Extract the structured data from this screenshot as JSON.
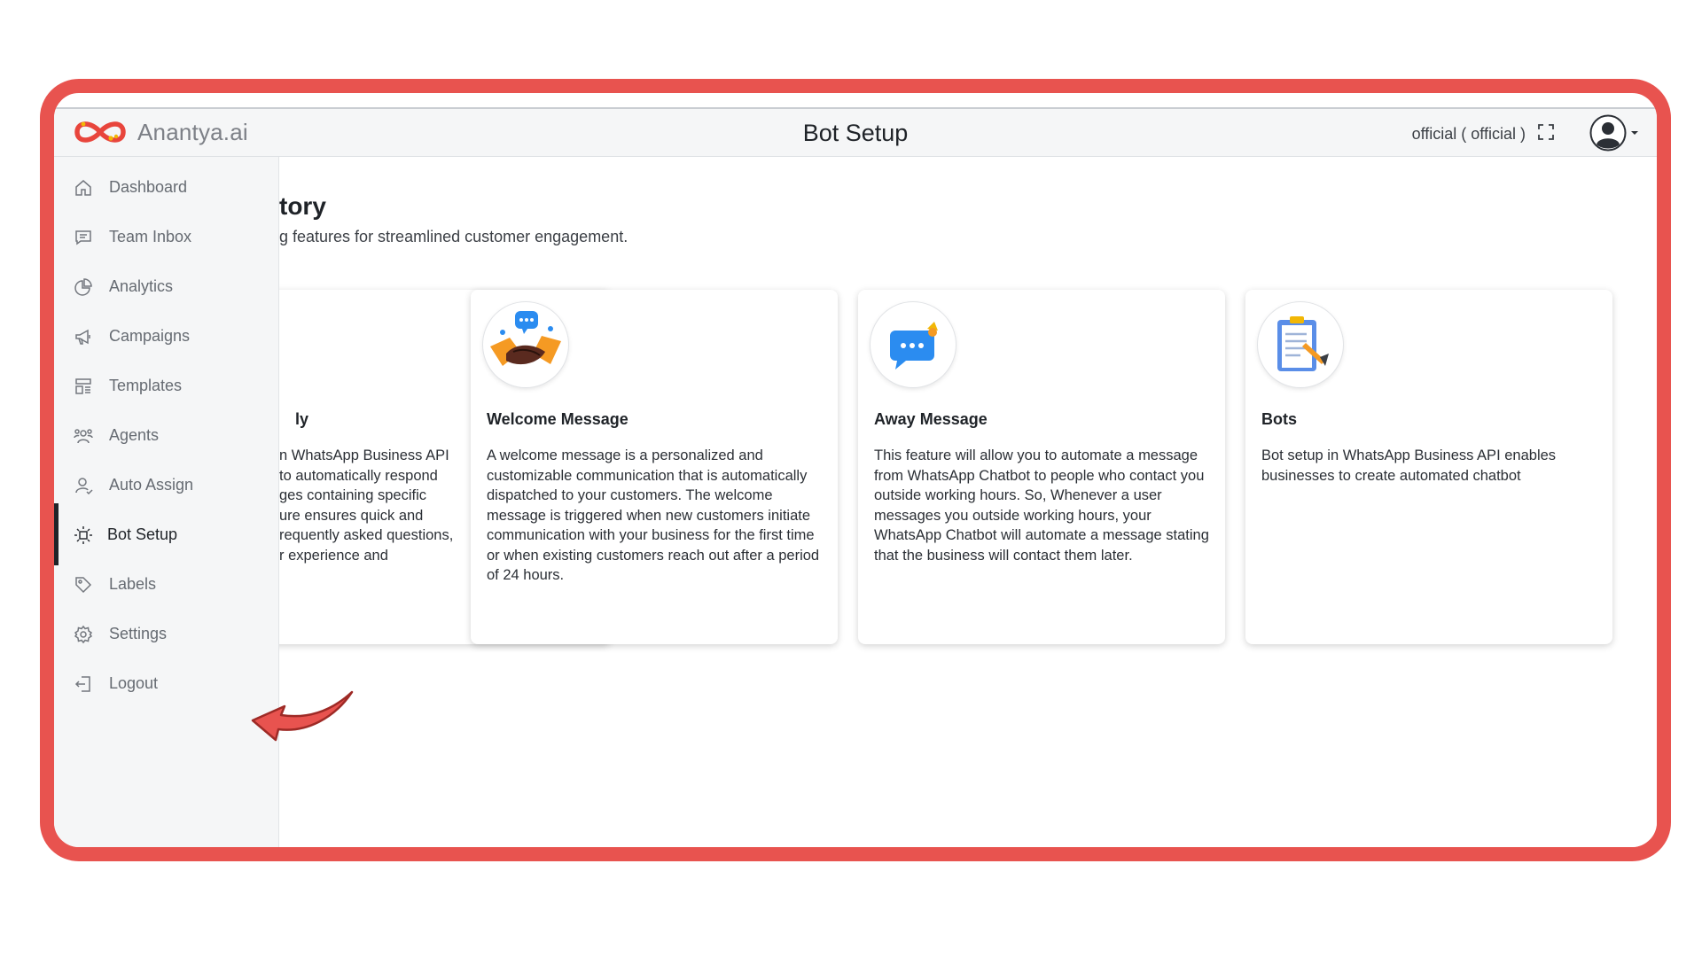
{
  "app": {
    "brand_name": "Anantya.ai",
    "page_title": "Bot Setup",
    "account_label": "official ( official )"
  },
  "sidebar": {
    "items": [
      {
        "label": "Dashboard",
        "icon": "home-icon"
      },
      {
        "label": "Team Inbox",
        "icon": "chat-icon"
      },
      {
        "label": "Analytics",
        "icon": "pie-chart-icon"
      },
      {
        "label": "Campaigns",
        "icon": "megaphone-icon"
      },
      {
        "label": "Templates",
        "icon": "template-icon"
      },
      {
        "label": "Agents",
        "icon": "agents-icon"
      },
      {
        "label": "Auto Assign",
        "icon": "user-icon"
      },
      {
        "label": "Bot Setup",
        "icon": "bot-icon",
        "active": true
      },
      {
        "label": "Labels",
        "icon": "tag-icon"
      },
      {
        "label": "Settings",
        "icon": "gear-icon"
      },
      {
        "label": "Logout",
        "icon": "logout-icon"
      }
    ]
  },
  "main": {
    "heading_visible": "tory",
    "subheading_visible": "g features for streamlined customer engagement.",
    "cards": [
      {
        "title": "ly",
        "description": "n WhatsApp Business API\n to automatically respond\nges containing specific\nure ensures quick and\nrequently asked questions,\nr experience and"
      },
      {
        "title": "Welcome Message",
        "description": "A welcome message is a personalized and customizable communication that is automatically dispatched to your customers. The welcome message is triggered when new customers initiate communication with your business for the first time or when existing customers reach out after a period of 24 hours."
      },
      {
        "title": "Away Message",
        "description": "This feature will allow you to automate a message from WhatsApp Chatbot to people who contact you outside working hours. So, Whenever a user messages you outside working hours, your WhatsApp Chatbot will automate a message stating that the business will contact them later."
      },
      {
        "title": "Bots",
        "description": "Bot setup in WhatsApp Business API enables businesses to create automated chatbot"
      }
    ]
  },
  "colors": {
    "frame_border": "#e8534f",
    "brand_red": "#e8453c",
    "brand_yellow": "#f2b705",
    "sidebar_bg": "#f5f6f7",
    "active_indicator": "#1f2328"
  }
}
